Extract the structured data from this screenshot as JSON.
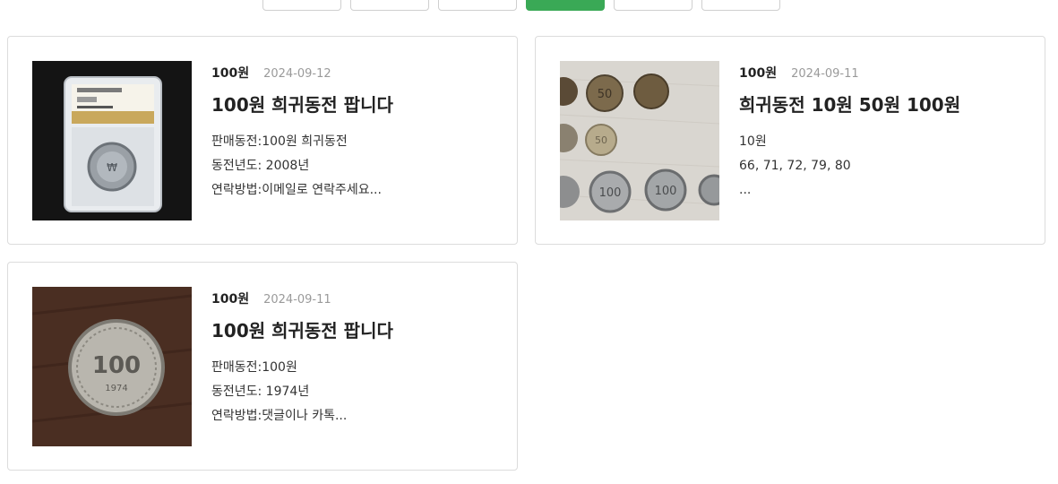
{
  "tabs": [
    {
      "label": "",
      "active": false
    },
    {
      "label": "",
      "active": false
    },
    {
      "label": "",
      "active": false
    },
    {
      "label": "",
      "active": true
    },
    {
      "label": "",
      "active": false
    },
    {
      "label": "",
      "active": false
    }
  ],
  "colors": {
    "accent": "#3aa956",
    "border": "#dcdcdc",
    "date": "#9a9a9a"
  },
  "posts": [
    {
      "category": "100원",
      "date": "2024-09-12",
      "title": "100원 희귀동전 팝니다",
      "lines": [
        "판매동전:100원 희귀동전",
        "동전년도: 2008년",
        "연락방법:이메일로 연락주세요..."
      ],
      "image": "graded-coin-slab-photo"
    },
    {
      "category": "100원",
      "date": "2024-09-11",
      "title": "희귀동전 10원 50원 100원",
      "lines": [
        "10원",
        "66, 71, 72, 79, 80",
        "..."
      ],
      "image": "multiple-coins-photo"
    },
    {
      "category": "100원",
      "date": "2024-09-11",
      "title": "100원 희귀동전 팝니다",
      "lines": [
        "판매동전:100원",
        "동전년도: 1974년",
        "연락방법:댓글이나 카톡..."
      ],
      "image": "single-100-won-coin-photo"
    }
  ]
}
